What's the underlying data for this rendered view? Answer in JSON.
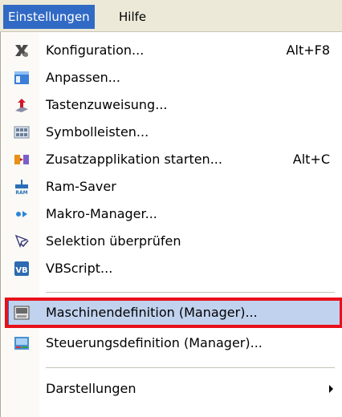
{
  "menubar": {
    "items": [
      {
        "label": "Einstellungen"
      },
      {
        "label": "Hilfe"
      }
    ]
  },
  "menu": {
    "items": [
      {
        "label": "Konfiguration...",
        "shortcut": "Alt+F8",
        "icon": "config-icon"
      },
      {
        "label": "Anpassen...",
        "shortcut": "",
        "icon": "customize-icon"
      },
      {
        "label": "Tastenzuweisung...",
        "shortcut": "",
        "icon": "key-assignment-icon"
      },
      {
        "label": "Symbolleisten...",
        "shortcut": "",
        "icon": "toolbars-icon"
      },
      {
        "label": "Zusatzapplikation starten...",
        "shortcut": "Alt+C",
        "icon": "start-app-icon"
      },
      {
        "label": "Ram-Saver",
        "shortcut": "",
        "icon": "ram-icon"
      },
      {
        "label": "Makro-Manager...",
        "shortcut": "",
        "icon": "macro-icon"
      },
      {
        "label": "Selektion überprüfen",
        "shortcut": "",
        "icon": "check-selection-icon"
      },
      {
        "label": "VBScript...",
        "shortcut": "",
        "icon": "vbscript-icon"
      },
      {
        "label": "Maschinendefinition (Manager)...",
        "shortcut": "",
        "icon": "machine-icon"
      },
      {
        "label": "Steuerungsdefinition (Manager)...",
        "shortcut": "",
        "icon": "control-icon"
      },
      {
        "label": "Darstellungen",
        "shortcut": "",
        "icon": ""
      }
    ]
  },
  "colors": {
    "highlight_fill": "#c1d2ee",
    "highlight_border": "#316ac5",
    "annotation_red": "#e8101a",
    "menubar_active": "#316ac5"
  }
}
